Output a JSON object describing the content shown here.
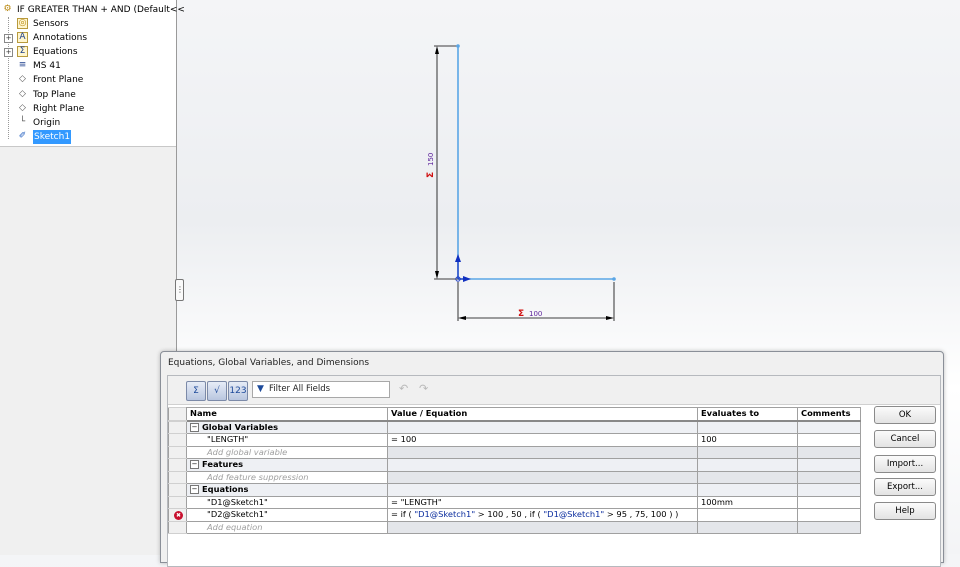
{
  "feature_tree": {
    "root_label": "IF GREATER THAN + AND  (Default<<",
    "items": [
      {
        "label": "Sensors",
        "icon": "sensors-icon",
        "expandable": false
      },
      {
        "label": "Annotations",
        "icon": "annotations-icon",
        "expandable": true
      },
      {
        "label": "Equations",
        "icon": "equations-icon",
        "expandable": true
      },
      {
        "label": "MS 41",
        "icon": "material-icon",
        "expandable": false
      },
      {
        "label": "Front Plane",
        "icon": "plane-icon",
        "expandable": false
      },
      {
        "label": "Top Plane",
        "icon": "plane-icon",
        "expandable": false
      },
      {
        "label": "Right Plane",
        "icon": "plane-icon",
        "expandable": false
      },
      {
        "label": "Origin",
        "icon": "origin-icon",
        "expandable": false
      },
      {
        "label": "Sketch1",
        "icon": "sketch-icon",
        "expandable": false,
        "selected": true
      }
    ]
  },
  "sketch": {
    "vertical_dim": "150",
    "horizontal_dim": "100",
    "equation_symbol": "Σ",
    "line_color": "#5aa6e6",
    "dim_symbol_color": "#d01010",
    "dim_text_color": "#5a1f9a"
  },
  "dialog": {
    "title": "Equations, Global Variables, and Dimensions",
    "filter_placeholder": "Filter All Fields",
    "columns": [
      "Name",
      "Value / Equation",
      "Evaluates to",
      "Comments"
    ],
    "sections": [
      {
        "title": "Global Variables",
        "rows": [
          {
            "name": "\"LENGTH\"",
            "value": "= 100",
            "evaluates": "100",
            "comment": ""
          }
        ],
        "add_placeholder": "Add global variable"
      },
      {
        "title": "Features",
        "rows": [],
        "add_placeholder": "Add feature suppression"
      },
      {
        "title": "Equations",
        "rows": [
          {
            "name": "\"D1@Sketch1\"",
            "value_parts": [
              {
                "t": "= ",
                "ref": false
              },
              {
                "t": "\"LENGTH\"",
                "ref": false
              }
            ],
            "evaluates": "100mm",
            "comment": "",
            "error": false
          },
          {
            "name": "\"D2@Sketch1\"",
            "value_parts": [
              {
                "t": "= if ( ",
                "ref": false
              },
              {
                "t": "\"D1@Sketch1\"",
                "ref": true
              },
              {
                "t": " > 100 , 50 , if ( ",
                "ref": false
              },
              {
                "t": "\"D1@Sketch1\"",
                "ref": true
              },
              {
                "t": " > 95 , 75, 100 ) )",
                "ref": false
              }
            ],
            "evaluates": "",
            "comment": "",
            "error": true
          }
        ],
        "add_placeholder": "Add equation"
      }
    ],
    "buttons": {
      "ok": "OK",
      "cancel": "Cancel",
      "import": "Import...",
      "export": "Export...",
      "help": "Help"
    }
  }
}
